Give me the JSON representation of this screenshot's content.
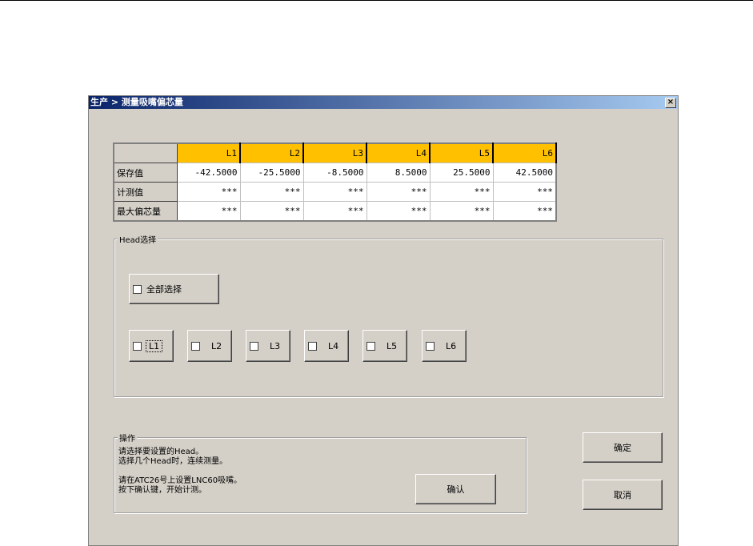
{
  "window": {
    "title": "生产 > 测量吸嘴偏芯量",
    "close": "×"
  },
  "table": {
    "columns": [
      "L1",
      "L2",
      "L3",
      "L4",
      "L5",
      "L6"
    ],
    "rows": [
      {
        "label": "保存值",
        "values": [
          "-42.5000",
          "-25.5000",
          "-8.5000",
          "8.5000",
          "25.5000",
          "42.5000"
        ]
      },
      {
        "label": "计测值",
        "values": [
          "***",
          "***",
          "***",
          "***",
          "***",
          "***"
        ]
      },
      {
        "label": "最大偏芯量",
        "values": [
          "***",
          "***",
          "***",
          "***",
          "***",
          "***"
        ]
      }
    ]
  },
  "head_group": {
    "label": "Head选择",
    "select_all": "全部选择",
    "heads": [
      "L1",
      "L2",
      "L3",
      "L4",
      "L5",
      "L6"
    ]
  },
  "operation": {
    "label": "操作",
    "lines": [
      "请选择要设置的Head。",
      "选择几个Head时，连续测量。",
      "",
      "请在ATC26号上设置LNC60吸嘴。",
      "按下确认键，开始计测。"
    ],
    "confirm": "确认"
  },
  "buttons": {
    "ok": "确定",
    "cancel": "取消"
  }
}
